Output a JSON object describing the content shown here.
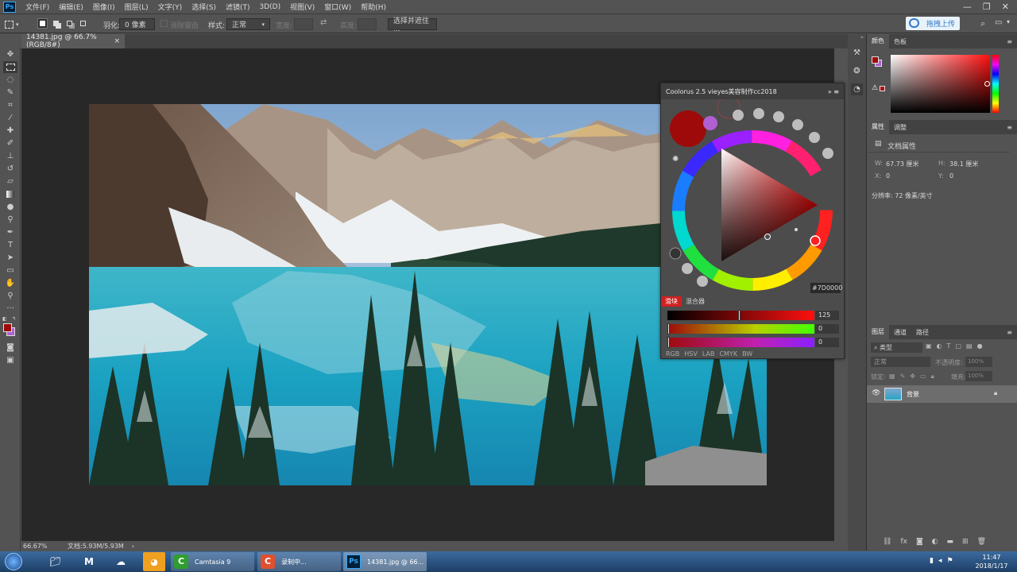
{
  "menubar": {
    "items": [
      "文件(F)",
      "编辑(E)",
      "图像(I)",
      "图层(L)",
      "文字(Y)",
      "选择(S)",
      "滤镜(T)",
      "3D(D)",
      "视图(V)",
      "窗口(W)",
      "帮助(H)"
    ]
  },
  "options": {
    "feather_label": "羽化:",
    "feather_value": "0 像素",
    "antialias_label": "消除锯齿",
    "style_label": "样式:",
    "style_value": "正常",
    "width_label": "宽度:",
    "height_label": "高度:",
    "select_mask_button": "选择并遮住 ..."
  },
  "top_right": {
    "upload_button": "拖拽上传"
  },
  "document": {
    "tab_title": "14381.jpg @ 66.7%(RGB/8#)",
    "zoom": "66.67%",
    "doc_size": "文档:5.93M/5.93M"
  },
  "coolorus": {
    "title": "Coolorus 2.5 vieyes美容制作cc2018",
    "hex_prefix": "#",
    "hex_value": "7D0000",
    "tabs": [
      "滑块",
      "混合器"
    ],
    "mode_tabs": [
      "RGB",
      "HSV",
      "LAB",
      "CMYK",
      "BW"
    ],
    "sliders": [
      {
        "value": "125",
        "fraction": 0.49
      },
      {
        "value": "0",
        "fraction": 0.0
      },
      {
        "value": "0",
        "fraction": 0.0
      }
    ],
    "current_color": "#9e0a0a",
    "secondary_color": "#b060d0"
  },
  "color_panel": {
    "tabs": [
      "颜色",
      "色板"
    ]
  },
  "properties_panel": {
    "tabs": [
      "属性",
      "调整"
    ],
    "section_title": "文档属性",
    "w_label": "W:",
    "w_value": "67.73 厘米",
    "h_label": "H:",
    "h_value": "38.1 厘米",
    "x_label": "X:",
    "x_value": "0",
    "y_label": "Y:",
    "y_value": "0",
    "resolution": "分辨率: 72 像素/英寸"
  },
  "layers_panel": {
    "tabs": [
      "图层",
      "通道",
      "路径"
    ],
    "filter_label": "类型",
    "blend_mode": "正常",
    "opacity_label": "不透明度:",
    "opacity_value": "100%",
    "lock_label": "锁定:",
    "fill_label": "填充:",
    "fill_value": "100%",
    "layers": [
      {
        "name": "背景"
      }
    ]
  },
  "taskbar": {
    "camtasia_label": "Camtasia 9",
    "record_label": "录制中...",
    "ps_label": "14381.jpg @ 66...",
    "time": "11:47",
    "date": "2018/1/17"
  },
  "colors": {
    "fg_swatch": "#9e0a0a",
    "bg_swatch": "#b060d0",
    "accent_blue": "#31a8ff"
  }
}
